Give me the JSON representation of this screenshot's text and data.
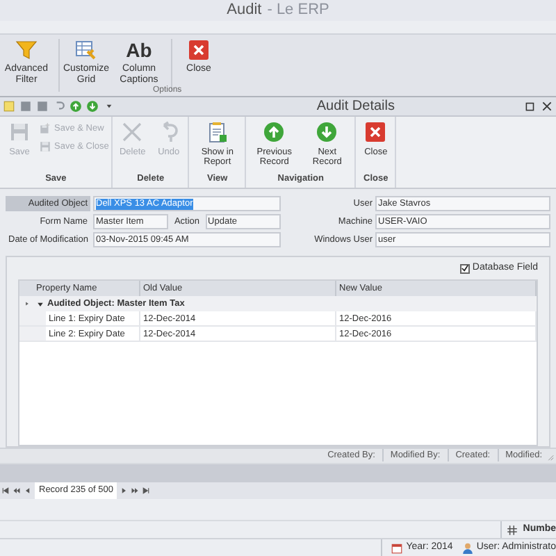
{
  "window": {
    "title": "Audit",
    "subtitle": "- Le ERP"
  },
  "ribbon": {
    "buttons": [
      {
        "label": "Advanced Filter"
      },
      {
        "label": "Customize Grid"
      },
      {
        "glyph": "Ab",
        "label": "Column Captions"
      },
      {
        "label": "Close"
      }
    ],
    "group_label": "Options"
  },
  "dialog": {
    "title": "Audit Details",
    "groups": [
      {
        "label": "Save",
        "items": [
          {
            "kind": "large",
            "label": "Save",
            "disabled": true
          },
          {
            "kind": "small",
            "label": "Save & New",
            "disabled": true
          },
          {
            "kind": "small",
            "label": "Save & Close",
            "disabled": true
          }
        ]
      },
      {
        "label": "Delete",
        "items": [
          {
            "kind": "large",
            "label": "Delete",
            "disabled": true
          },
          {
            "kind": "large",
            "label": "Undo",
            "disabled": true
          }
        ]
      },
      {
        "label": "View",
        "items": [
          {
            "kind": "large",
            "label": "Show in Report",
            "disabled": false
          }
        ]
      },
      {
        "label": "Navigation",
        "items": [
          {
            "kind": "large",
            "label": "Previous Record",
            "disabled": false
          },
          {
            "kind": "large",
            "label": "Next Record",
            "disabled": false
          }
        ]
      },
      {
        "label": "Close",
        "items": [
          {
            "kind": "large",
            "label": "Close",
            "disabled": false
          }
        ]
      }
    ],
    "fields_left": [
      [
        {
          "label": "Audited Object",
          "value": "Dell XPS 13 AC Adaptor",
          "selected": true
        }
      ],
      [
        {
          "label": "Form Name",
          "value": "Master Item",
          "selected": false
        },
        {
          "label": "Action",
          "value": "Update",
          "selected": false
        }
      ],
      [
        {
          "label": "Date of Modification",
          "value": "03-Nov-2015 09:45 AM",
          "selected": false
        }
      ]
    ],
    "fields_right": [
      {
        "label": "User",
        "value": "Jake Stavros"
      },
      {
        "label": "Machine",
        "value": "USER-VAIO"
      },
      {
        "label": "Windows User",
        "value": "user"
      }
    ],
    "checkbox": {
      "label": "Database Field",
      "checked": true
    },
    "grid": {
      "columns": [
        "Property Name",
        "Old Value",
        "New Value"
      ],
      "group": {
        "label": "Audited Object: Master Item Tax",
        "expanded": true,
        "rows": [
          [
            "Line 1: Expiry Date",
            "12-Dec-2014",
            "12-Dec-2016"
          ],
          [
            "Line 2: Expiry Date",
            "12-Dec-2014",
            "12-Dec-2016"
          ]
        ]
      }
    },
    "footer": [
      "Created By:",
      "Modified By:",
      "Created:",
      "Modified:"
    ]
  },
  "navigator": {
    "text": "Record 235 of 500"
  },
  "status": {
    "numbering": "Numbe",
    "items": [
      {
        "text": "Year: 2014"
      },
      {
        "text": "User: Administrato"
      }
    ]
  }
}
